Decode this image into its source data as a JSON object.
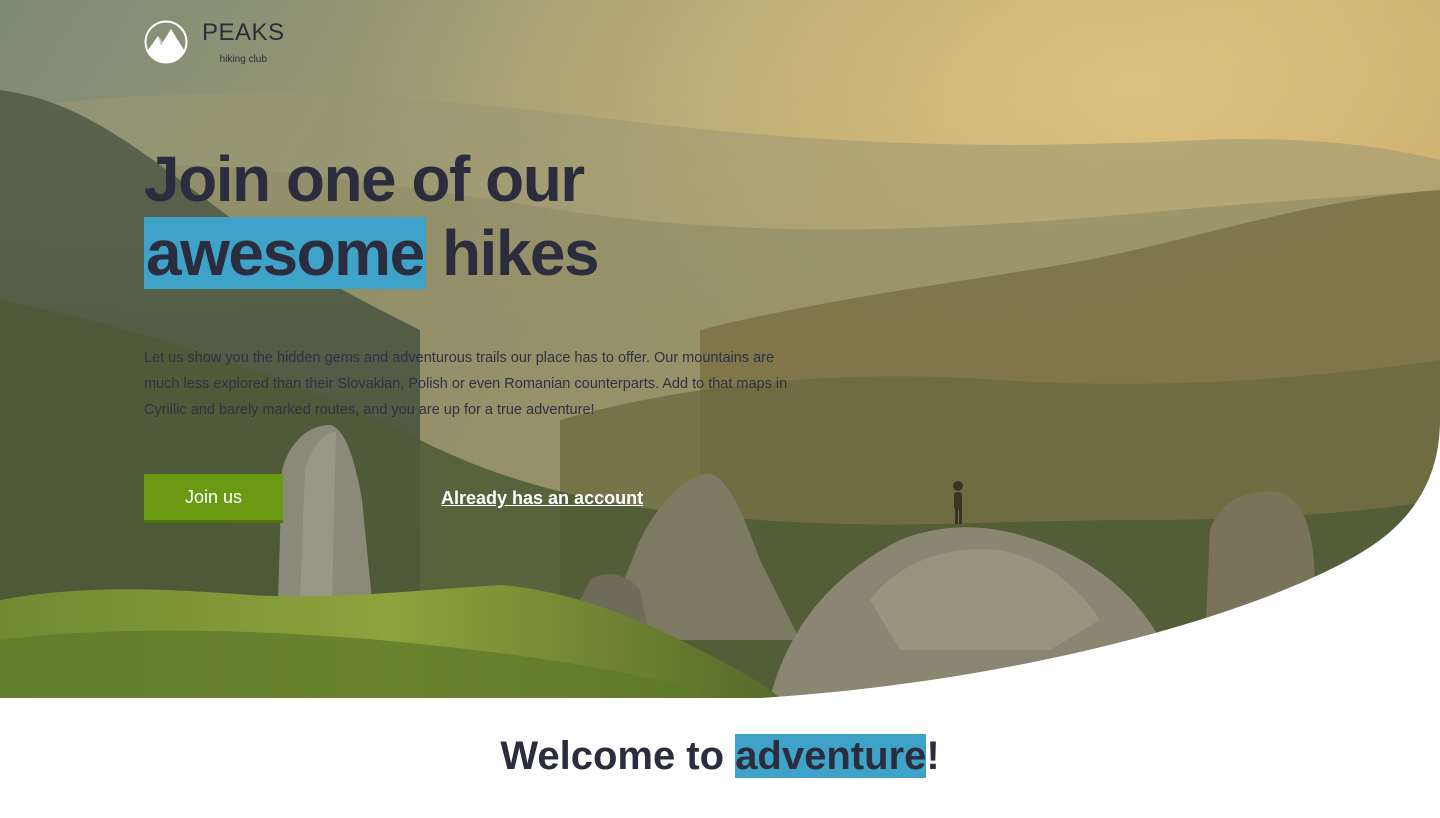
{
  "brand": {
    "name": "PEAKS",
    "tagline": "hiking club"
  },
  "hero": {
    "title_line1": "Join one of our",
    "title_highlight": "awesome",
    "title_rest": "hikes",
    "description": "Let us show you the hidden gems and adventurous trails our place has to offer. Our mountains are much less explored than their Slovakian, Polish or even Romanian counterparts. Add to that maps in Cyrillic and barely marked routes, and you are up for a true adventure!",
    "primary_button": "Join us",
    "secondary_link": "Already has an account"
  },
  "welcome": {
    "prefix": "Welcome to ",
    "highlight": "adventure",
    "suffix": "!"
  },
  "colors": {
    "text_dark": "#2b2d3e",
    "highlight_blue": "#3fa3c9",
    "button_green": "#6a9a12",
    "white": "#ffffff"
  },
  "icons": {
    "logo": "mountain-icon"
  }
}
